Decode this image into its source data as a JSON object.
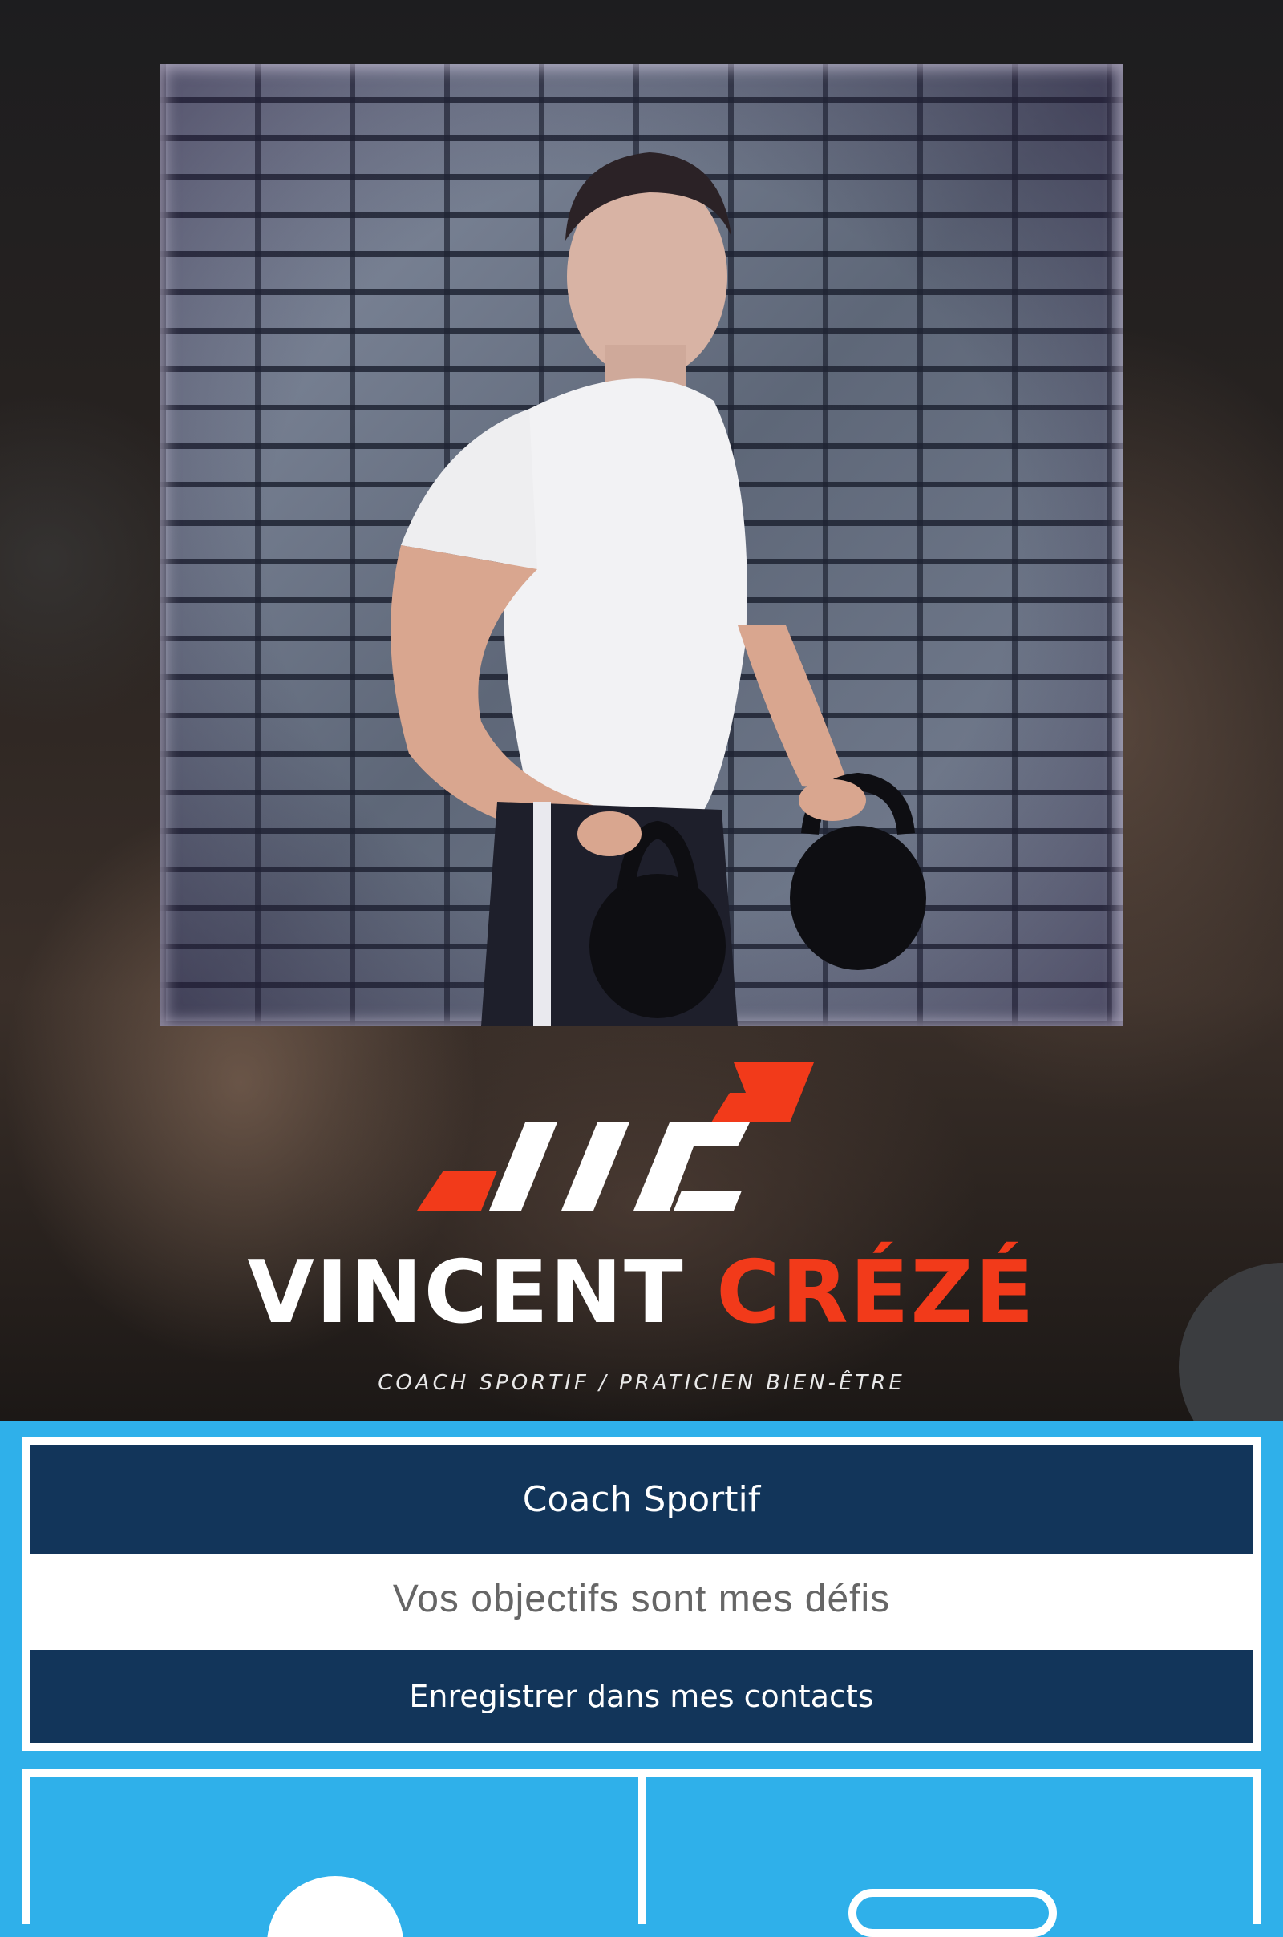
{
  "hero": {
    "brand_first": "VINCENT",
    "brand_last": "CRÉZÉ",
    "tagline": "COACH SPORTIF / PRATICIEN BIEN-ÊTRE"
  },
  "profile": {
    "title": "Coach Sportif",
    "subtitle": "Vos objectifs sont mes défis",
    "save_contact_label": "Enregistrer dans mes contacts"
  },
  "action_tiles": [
    {
      "icon": "user-icon"
    },
    {
      "icon": "phone-icon"
    }
  ],
  "colors": {
    "background": "#2fb0ea",
    "bar": "#12355a",
    "brand_accent": "#f23a1a"
  }
}
